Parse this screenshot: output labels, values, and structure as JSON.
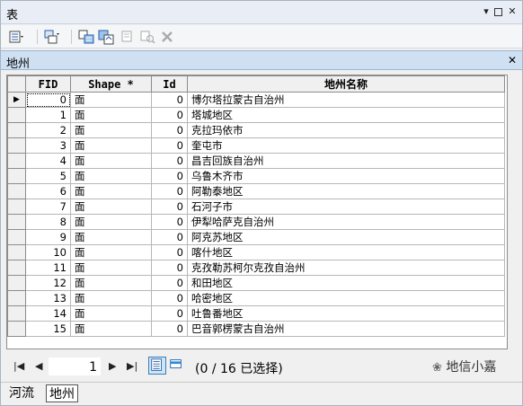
{
  "window": {
    "title": "表"
  },
  "toolbar": {
    "icons": [
      "table-options-icon",
      "related-tables-icon",
      "select-by-attributes-icon",
      "switch-selection-icon",
      "clear-selection-icon",
      "zoom-to-selected-icon",
      "delete-selected-icon"
    ]
  },
  "table": {
    "name": "地州",
    "columns": [
      "FID",
      "Shape *",
      "Id",
      "地州名称"
    ],
    "rows": [
      {
        "fid": "0",
        "shape": "面",
        "id": "0",
        "name": "博尔塔拉蒙古自治州"
      },
      {
        "fid": "1",
        "shape": "面",
        "id": "0",
        "name": "塔城地区"
      },
      {
        "fid": "2",
        "shape": "面",
        "id": "0",
        "name": "克拉玛依市"
      },
      {
        "fid": "3",
        "shape": "面",
        "id": "0",
        "name": "奎屯市"
      },
      {
        "fid": "4",
        "shape": "面",
        "id": "0",
        "name": "昌吉回族自治州"
      },
      {
        "fid": "5",
        "shape": "面",
        "id": "0",
        "name": "乌鲁木齐市"
      },
      {
        "fid": "6",
        "shape": "面",
        "id": "0",
        "name": "阿勒泰地区"
      },
      {
        "fid": "7",
        "shape": "面",
        "id": "0",
        "name": "石河子市"
      },
      {
        "fid": "8",
        "shape": "面",
        "id": "0",
        "name": "伊犁哈萨克自治州"
      },
      {
        "fid": "9",
        "shape": "面",
        "id": "0",
        "name": "阿克苏地区"
      },
      {
        "fid": "10",
        "shape": "面",
        "id": "0",
        "name": "喀什地区"
      },
      {
        "fid": "11",
        "shape": "面",
        "id": "0",
        "name": "克孜勒苏柯尔克孜自治州"
      },
      {
        "fid": "12",
        "shape": "面",
        "id": "0",
        "name": "和田地区"
      },
      {
        "fid": "13",
        "shape": "面",
        "id": "0",
        "name": "哈密地区"
      },
      {
        "fid": "14",
        "shape": "面",
        "id": "0",
        "name": "吐鲁番地区"
      },
      {
        "fid": "15",
        "shape": "面",
        "id": "0",
        "name": "巴音郭楞蒙古自治州"
      }
    ]
  },
  "navigation": {
    "current_record": "1",
    "selection_status": "(0 / 16 已选择)"
  },
  "watermark": "地信小嘉",
  "tabs": [
    "河流",
    "地州"
  ],
  "colors": {
    "header_band": "#cfe0f3",
    "active_view": "#cde6f7"
  }
}
